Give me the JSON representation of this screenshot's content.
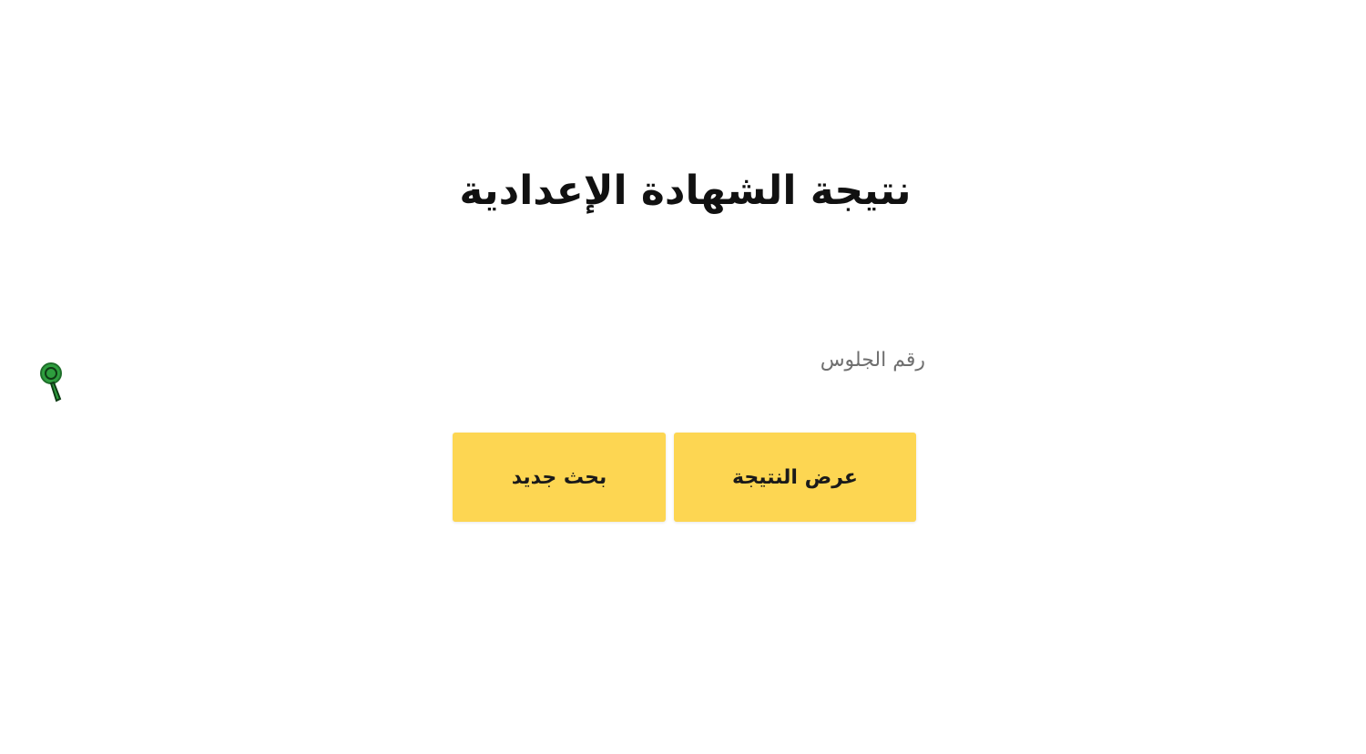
{
  "page": {
    "title": "نتيجة الشهادة الإعدادية"
  },
  "form": {
    "seat_number_placeholder": "رقم الجلوس",
    "seat_number_value": ""
  },
  "buttons": {
    "show_result_label": "عرض النتيجة",
    "new_search_label": "بحث جديد"
  },
  "watermark": {
    "icon": "magnifier-icon"
  },
  "colors": {
    "button_background": "#fdd652",
    "title_text": "#111111",
    "placeholder_text": "#6f6f6f",
    "watermark_icon": "#2e9e3e"
  }
}
